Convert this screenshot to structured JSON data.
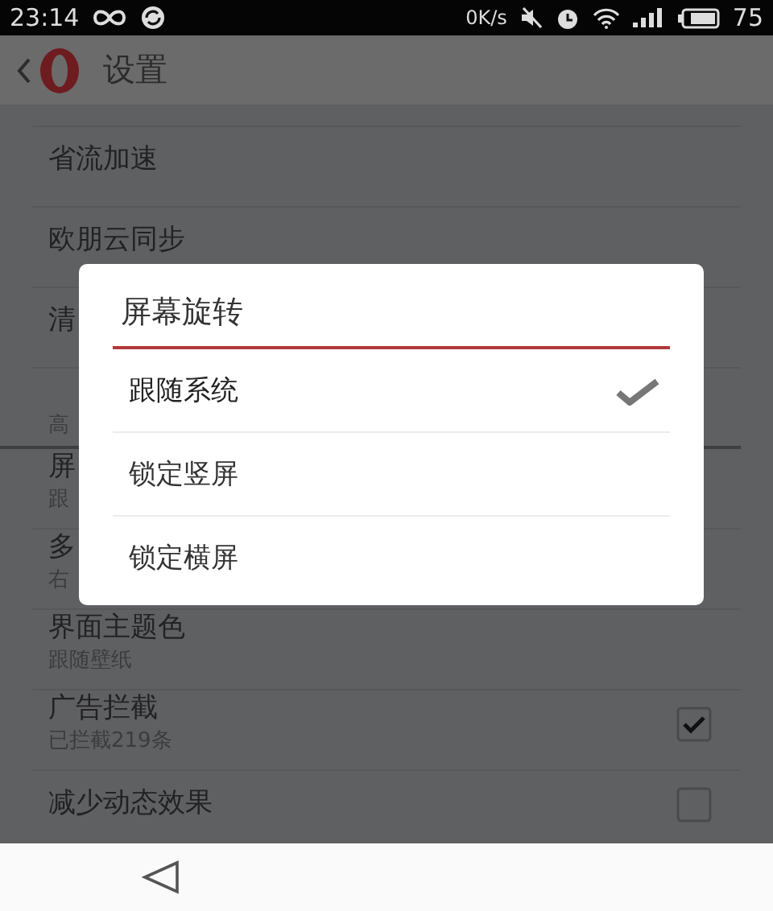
{
  "status_bar": {
    "time": "23:14",
    "net_speed": "0K/s",
    "battery": "75"
  },
  "header": {
    "title": "设置"
  },
  "settings": [
    {
      "kind": "item",
      "title": "省流加速"
    },
    {
      "kind": "item",
      "title": "欧朋云同步"
    },
    {
      "kind": "item",
      "title": "清"
    },
    {
      "kind": "section",
      "title": "高"
    },
    {
      "kind": "item",
      "title": "屏",
      "subtitle": "跟"
    },
    {
      "kind": "item",
      "title": "多",
      "subtitle": "右"
    },
    {
      "kind": "item",
      "title": "界面主题色",
      "subtitle": "跟随壁纸"
    },
    {
      "kind": "checkbox",
      "title": "广告拦截",
      "subtitle": "已拦截219条",
      "checked": true
    },
    {
      "kind": "checkbox",
      "title": "减少动态效果",
      "checked": false
    }
  ],
  "dialog": {
    "title": "屏幕旋转",
    "options": [
      {
        "label": "跟随系统",
        "selected": true
      },
      {
        "label": "锁定竖屏",
        "selected": false
      },
      {
        "label": "锁定横屏",
        "selected": false
      }
    ]
  }
}
